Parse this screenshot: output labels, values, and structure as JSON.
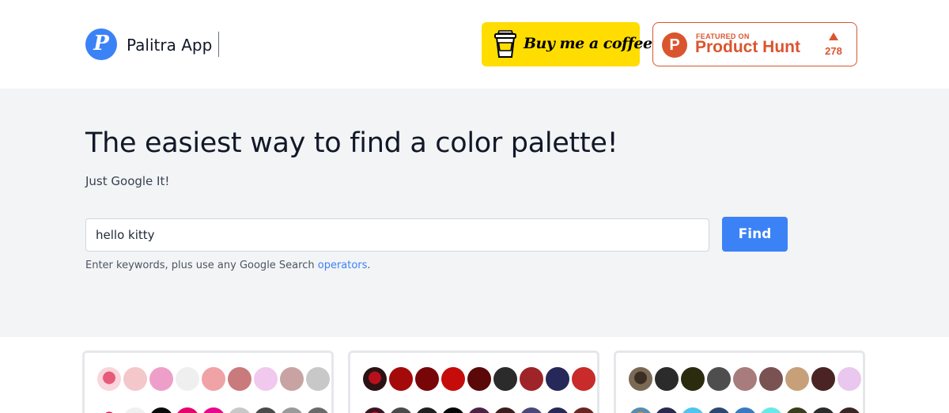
{
  "header": {
    "app_name": "Palitra App",
    "logo_letter": "P",
    "bmc_label": "Buy me a coffee",
    "product_hunt": {
      "featured_label": "FEATURED ON",
      "name": "Product Hunt",
      "logo_letter": "P",
      "upvotes": "278"
    }
  },
  "hero": {
    "title": "The easiest way to find a color palette!",
    "subtitle": "Just Google It!",
    "search_value": "hello kitty",
    "find_label": "Find",
    "hint_text": "Enter keywords, plus use any Google Search ",
    "hint_link": "operators",
    "hint_end": "."
  },
  "colors": {
    "accent": "#3b82f6",
    "bmc_yellow": "#ffdd00",
    "product_hunt": "#da552f",
    "hero_bg": "#f3f4f6"
  },
  "cards": [
    {
      "rows": [
        {
          "thumb": [
            "#f9d5dc",
            "#e85a7a"
          ],
          "swatches": [
            "#f4c7cb",
            "#ee9fc9",
            "#efefef",
            "#f0a3a6",
            "#c97a7c",
            "#f1c8ee",
            "#c9a3a3",
            "#c8c8c8"
          ]
        },
        {
          "thumb": [
            "#ffffff",
            "#d3124f"
          ],
          "swatches": [
            "#f0f0f0",
            "#0a0a0a",
            "#e4066d",
            "#e8088c",
            "#c8c8c8",
            "#4a4a4a",
            "#9a9a9a",
            "#6a6a6a"
          ]
        }
      ]
    },
    {
      "rows": [
        {
          "thumb": [
            "#2a1215",
            "#b8101a"
          ],
          "swatches": [
            "#a50a0b",
            "#780609",
            "#c60b0b",
            "#5a0808",
            "#2b2b2b",
            "#9e2428",
            "#252858",
            "#c92a2a"
          ]
        },
        {
          "thumb": [
            "#3a1420",
            "#c21830"
          ],
          "swatches": [
            "#4a4a4a",
            "#202020",
            "#050505",
            "#4e2242",
            "#3c1c1c",
            "#4a4878",
            "#282858",
            "#6a2424"
          ]
        }
      ]
    },
    {
      "rows": [
        {
          "thumb": [
            "#7a6a55",
            "#3a2e25"
          ],
          "swatches": [
            "#2b2b2b",
            "#2b2b0f",
            "#4e4e4e",
            "#a87c7c",
            "#7a5252",
            "#c7a07a",
            "#4a2424",
            "#eac7ee"
          ]
        },
        {
          "thumb": [
            "#5a8ab0",
            "#c89a2a"
          ],
          "swatches": [
            "#2a2a50",
            "#4fc4ef",
            "#2b4a6e",
            "#3a7ac0",
            "#6ae8e8",
            "#3c3c1e",
            "#2b2b2b",
            "#3a2424"
          ]
        }
      ]
    }
  ]
}
